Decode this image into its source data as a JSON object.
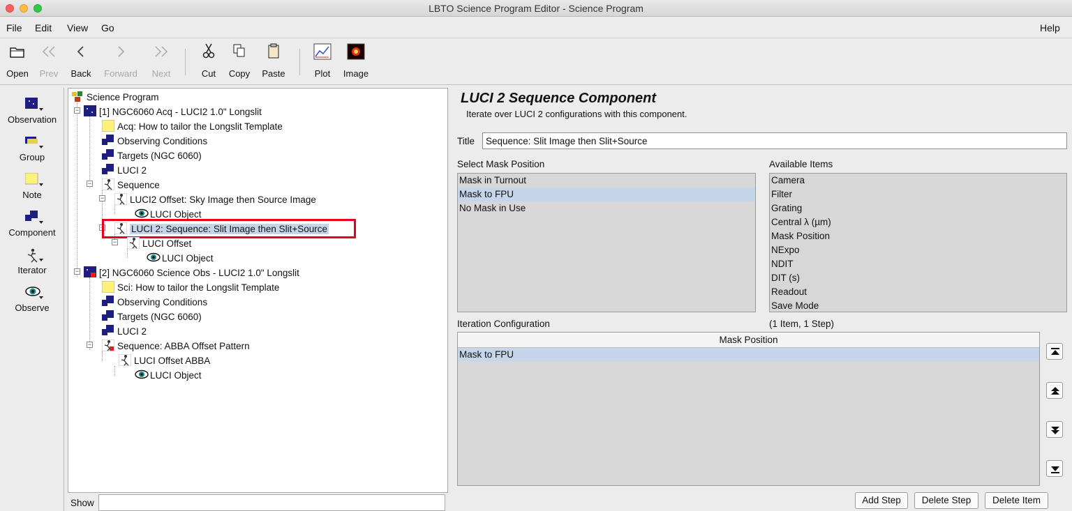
{
  "window": {
    "title": "LBTO Science Program Editor - Science Program"
  },
  "menubar": {
    "file": "File",
    "edit": "Edit",
    "view": "View",
    "go": "Go",
    "help": "Help"
  },
  "toolbar": {
    "open": "Open",
    "prev": "Prev",
    "back": "Back",
    "forward": "Forward",
    "next": "Next",
    "cut": "Cut",
    "copy": "Copy",
    "paste": "Paste",
    "plot": "Plot",
    "image": "Image"
  },
  "palette": {
    "observation": "Observation",
    "group": "Group",
    "note": "Note",
    "component": "Component",
    "iterator": "Iterator",
    "observe": "Observe"
  },
  "tree": {
    "root": "Science Program",
    "obs1": "[1] NGC6060 Acq - LUCI2 1.0\" Longslit",
    "acq_note": "Acq: How to tailor the Longslit Template",
    "obs_cond1": "Observing Conditions",
    "targets1": "Targets (NGC 6060)",
    "luci2_1": "LUCI 2",
    "sequence1": "Sequence",
    "luci2_offset": "LUCI2 Offset: Sky Image then Source Image",
    "luci_object1": "LUCI Object",
    "luci2_sequence": "LUCI 2: Sequence: Slit Image then Slit+Source",
    "luci_offset": "LUCI Offset",
    "luci_object2": "LUCI Object",
    "obs2": "[2] NGC6060 Science Obs  - LUCI2 1.0\" Longslit",
    "sci_note": "Sci: How to tailor the Longslit Template",
    "obs_cond2": "Observing Conditions",
    "targets2": "Targets (NGC 6060)",
    "luci2_2": "LUCI 2",
    "sequence_abba": "Sequence: ABBA Offset Pattern",
    "luci_offset_abba": "LUCI Offset ABBA",
    "luci_object3": "LUCI Object"
  },
  "show": {
    "label": "Show",
    "value": ""
  },
  "editor": {
    "heading": "LUCI 2 Sequence Component",
    "description": "Iterate over LUCI 2 configurations with this component.",
    "title_label": "Title",
    "title_value": "Sequence: Slit Image then Slit+Source",
    "mask_label": "Select Mask Position",
    "mask_options": [
      "Mask in Turnout",
      "Mask to FPU",
      "No Mask in Use"
    ],
    "mask_selected": "Mask to FPU",
    "available_label": "Available Items",
    "available_items": [
      "Camera",
      "Filter",
      "Grating",
      "Central λ (µm)",
      "Mask Position",
      "NExpo",
      "NDIT",
      "DIT (s)",
      "Readout",
      "Save Mode"
    ],
    "iteration_label": "Iteration Configuration",
    "iteration_count": "(1 Item, 1 Step)",
    "table_header": "Mask Position",
    "table_rows": [
      "Mask to FPU"
    ],
    "add_step": "Add Step",
    "delete_step": "Delete Step",
    "delete_item": "Delete Item"
  },
  "colors": {
    "selection": "#c5d6ea",
    "highlight": "#e5001c",
    "note_yellow": "#fff27a",
    "star_blue": "#1e1e80"
  }
}
